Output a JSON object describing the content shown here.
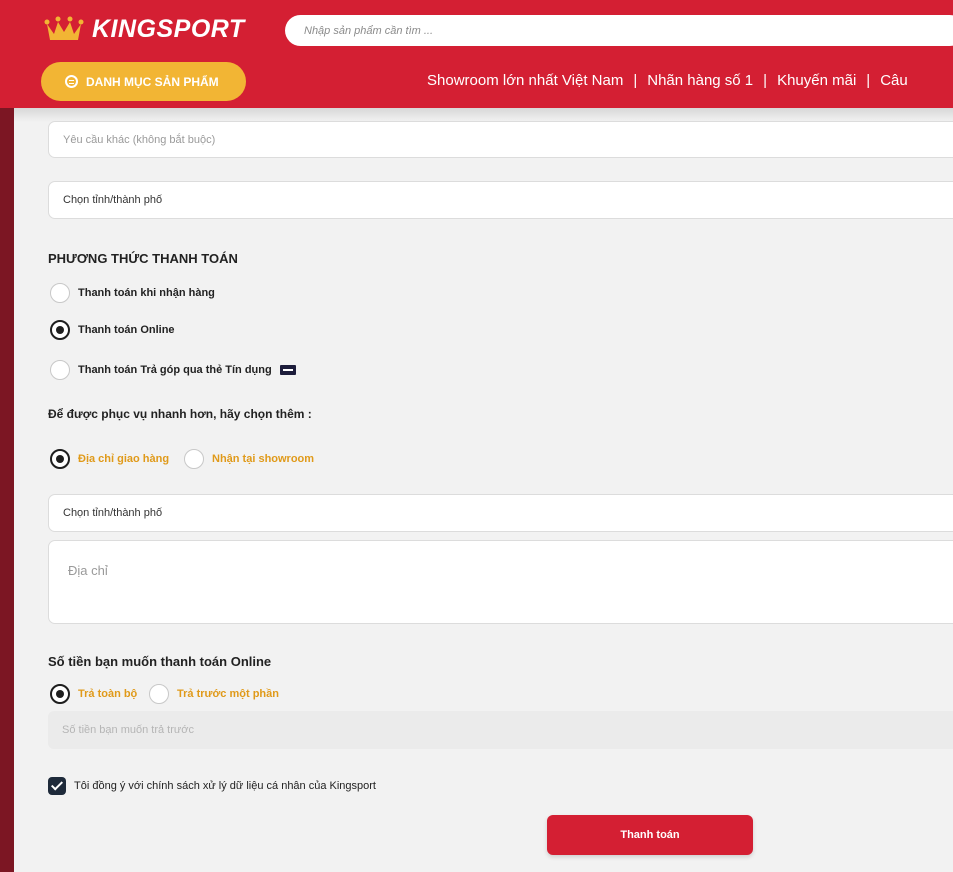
{
  "header": {
    "logo_text": "KINGSPORT",
    "search_placeholder": "Nhập sản phẩm cần tìm ...",
    "category_button": "DANH MỤC SẢN PHẨM",
    "nav": [
      "Showroom lớn nhất Việt Nam",
      "Nhãn hàng số 1",
      "Khuyến mãi",
      "Câu"
    ]
  },
  "form": {
    "other_request_placeholder": "Yêu cầu khác (không bắt buộc)",
    "city_select_top": "Chọn tỉnh/thành phố",
    "payment_heading": "PHƯƠNG THỨC THANH TOÁN",
    "payment_options": [
      {
        "label": "Thanh toán khi nhận hàng",
        "checked": false
      },
      {
        "label": "Thanh toán Online",
        "checked": true
      },
      {
        "label": "Thanh toán Trả góp qua thẻ Tín dụng",
        "checked": false
      }
    ],
    "card_icon": "visa-card-icon",
    "service_heading": "Để được phục vụ nhanh hơn, hãy chọn thêm :",
    "delivery_options": [
      {
        "label": "Địa chỉ giao hàng",
        "checked": true
      },
      {
        "label": "Nhận tại showroom",
        "checked": false
      }
    ],
    "city_select_bottom": "Chọn tỉnh/thành phố",
    "address_placeholder": "Địa chỉ",
    "online_amount_heading": "Số tiền bạn muốn thanh toán Online",
    "amount_options": [
      {
        "label": "Trả toàn bộ",
        "checked": true
      },
      {
        "label": "Trả trước một phần",
        "checked": false
      }
    ],
    "prepay_placeholder": "Số tiền bạn muốn trả trước",
    "consent_text": "Tôi đồng ý với chính sách xử lý dữ liệu cá nhân của Kingsport",
    "consent_checked": true,
    "submit_label": "Thanh toán"
  },
  "colors": {
    "brand_red": "#d41f33",
    "accent_yellow": "#f2b534",
    "option_orange": "#e09a1a"
  }
}
